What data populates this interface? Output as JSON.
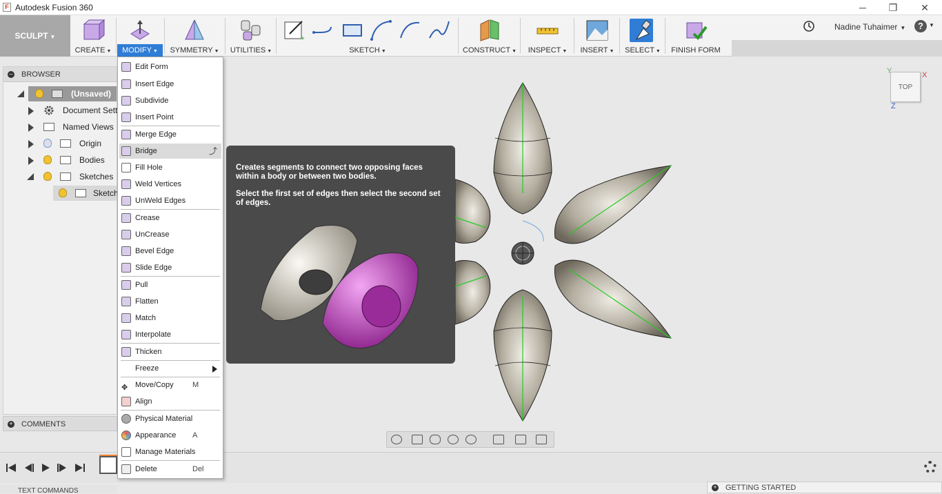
{
  "window": {
    "title": "Autodesk Fusion 360",
    "minimize": "─",
    "restore": "❐",
    "close": "✕"
  },
  "workspace": {
    "label": "SCULPT"
  },
  "toolbar": {
    "groups": [
      {
        "label": "CREATE"
      },
      {
        "label": "MODIFY"
      },
      {
        "label": "SYMMETRY"
      },
      {
        "label": "UTILITIES"
      },
      {
        "label": "SKETCH"
      },
      {
        "label": "CONSTRUCT"
      },
      {
        "label": "INSPECT"
      },
      {
        "label": "INSERT"
      },
      {
        "label": "SELECT"
      },
      {
        "label": "FINISH FORM"
      }
    ],
    "user": "Nadine Tuhaimer",
    "help": "?"
  },
  "browser": {
    "title": "BROWSER",
    "items": [
      {
        "label": "(Unsaved)"
      },
      {
        "label": "Document Settin"
      },
      {
        "label": "Named Views"
      },
      {
        "label": "Origin"
      },
      {
        "label": "Bodies"
      },
      {
        "label": "Sketches"
      },
      {
        "label": "Sketch"
      }
    ]
  },
  "comments": {
    "title": "COMMENTS"
  },
  "modify_menu": {
    "items": [
      {
        "label": "Edit Form",
        "shortcut": ""
      },
      {
        "label": "Insert Edge",
        "shortcut": ""
      },
      {
        "label": "Subdivide",
        "shortcut": ""
      },
      {
        "label": "Insert Point",
        "shortcut": ""
      },
      {
        "label": "Merge Edge",
        "shortcut": ""
      },
      {
        "label": "Bridge",
        "shortcut": ""
      },
      {
        "label": "Fill Hole",
        "shortcut": ""
      },
      {
        "label": "Weld Vertices",
        "shortcut": ""
      },
      {
        "label": "UnWeld Edges",
        "shortcut": ""
      },
      {
        "label": "Crease",
        "shortcut": ""
      },
      {
        "label": "UnCrease",
        "shortcut": ""
      },
      {
        "label": "Bevel Edge",
        "shortcut": ""
      },
      {
        "label": "Slide Edge",
        "shortcut": ""
      },
      {
        "label": "Pull",
        "shortcut": ""
      },
      {
        "label": "Flatten",
        "shortcut": ""
      },
      {
        "label": "Match",
        "shortcut": ""
      },
      {
        "label": "Interpolate",
        "shortcut": ""
      },
      {
        "label": "Thicken",
        "shortcut": ""
      },
      {
        "label": "Freeze",
        "shortcut": ""
      },
      {
        "label": "Move/Copy",
        "shortcut": "M"
      },
      {
        "label": "Align",
        "shortcut": ""
      },
      {
        "label": "Physical Material",
        "shortcut": ""
      },
      {
        "label": "Appearance",
        "shortcut": "A"
      },
      {
        "label": "Manage Materials",
        "shortcut": ""
      },
      {
        "label": "Delete",
        "shortcut": "Del"
      }
    ]
  },
  "tooltip": {
    "line1": "Creates segments to connect two opposing faces within a body or between two bodies.",
    "line2": "Select the first set of edges then select the second set of edges."
  },
  "viewcube": {
    "face": "TOP",
    "axis_x": "X",
    "axis_y": "Y",
    "axis_z": "Z"
  },
  "bottom": {
    "getting_started": "GETTING STARTED",
    "text_commands": "TEXT COMMANDS"
  },
  "colors": {
    "accent": "#2f7dd6",
    "body": "#b8b2a6",
    "edge_green": "#22cc22",
    "tooltip_bg": "#4a4a4a"
  }
}
